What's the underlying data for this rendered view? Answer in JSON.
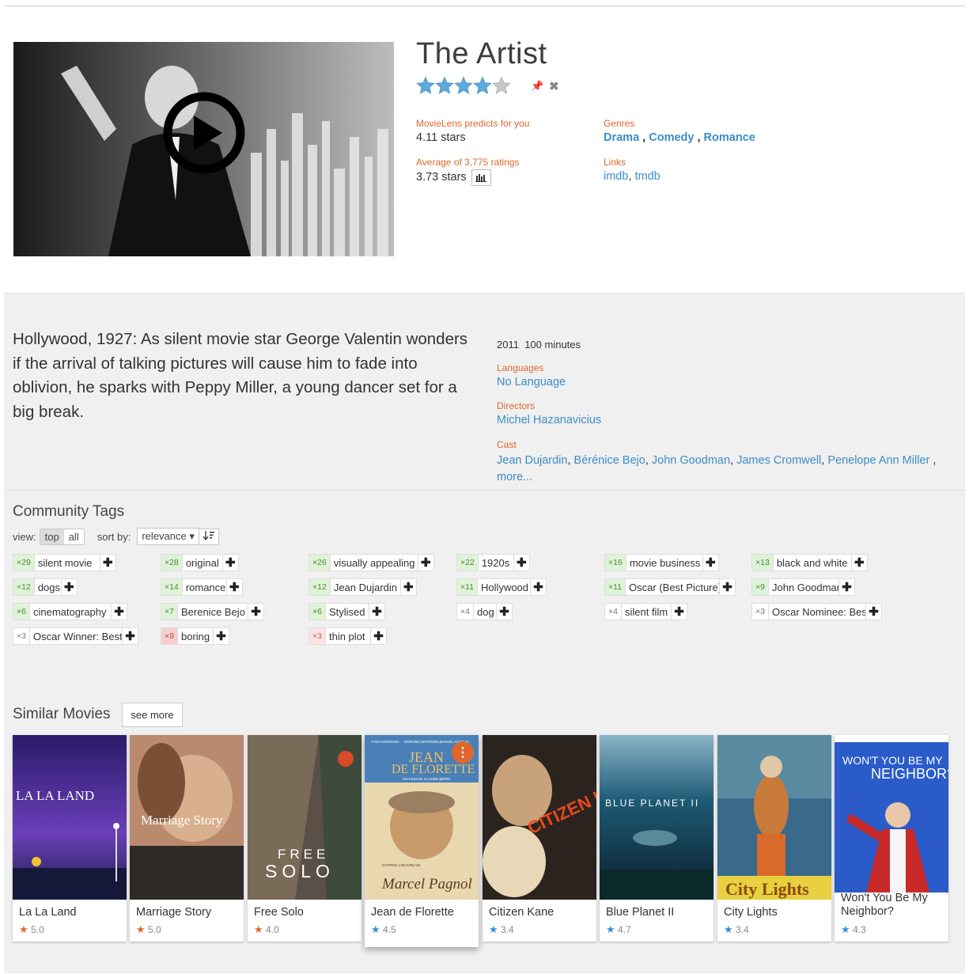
{
  "movie": {
    "title": "The Artist",
    "rating_stars": 4,
    "predict_label": "MovieLens predicts for you",
    "predict_value": "4.11 stars",
    "average_label": "Average of 3,775 ratings",
    "average_value": "3.73 stars",
    "genres_label": "Genres",
    "genres": [
      "Drama",
      "Comedy",
      "Romance"
    ],
    "links_label": "Links",
    "links": [
      "imdb",
      "tmdb"
    ]
  },
  "details": {
    "plot": "Hollywood, 1927: As silent movie star George Valentin wonders if the arrival of talking pictures will cause him to fade into oblivion, he sparks with Peppy Miller, a young dancer set for a big break.",
    "year": "2011",
    "runtime": "100 minutes",
    "languages_label": "Languages",
    "language": "No Language",
    "directors_label": "Directors",
    "director": "Michel Hazanavicius",
    "cast_label": "Cast",
    "cast": [
      "Jean Dujardin",
      "Bérénice Bejo",
      "John Goodman",
      "James Cromwell",
      "Penelope Ann Miller"
    ],
    "more": "more..."
  },
  "tags_section": {
    "title": "Community Tags",
    "view_label": "view:",
    "view_top": "top",
    "view_all": "all",
    "sort_label": "sort by:",
    "sort_value": "relevance ▾",
    "tags": [
      {
        "count": "×29",
        "name": "silent movie",
        "style": "green"
      },
      {
        "count": "×28",
        "name": "original",
        "style": "green"
      },
      {
        "count": "×26",
        "name": "visually appealing",
        "style": "green"
      },
      {
        "count": "×22",
        "name": "1920s",
        "style": "green"
      },
      {
        "count": "×16",
        "name": "movie business",
        "style": "green"
      },
      {
        "count": "×13",
        "name": "black and white",
        "style": "green"
      },
      {
        "count": "×12",
        "name": "dogs",
        "style": "green"
      },
      {
        "count": "×14",
        "name": "romance",
        "style": "green"
      },
      {
        "count": "×12",
        "name": "Jean Dujardin",
        "style": "green"
      },
      {
        "count": "×11",
        "name": "Hollywood",
        "style": "green"
      },
      {
        "count": "×11",
        "name": "Oscar (Best Picture)",
        "style": "green"
      },
      {
        "count": "×9",
        "name": "John Goodman",
        "style": "green"
      },
      {
        "count": "×6",
        "name": "cinematography",
        "style": "green"
      },
      {
        "count": "×7",
        "name": "Berenice Bejo",
        "style": "green"
      },
      {
        "count": "×6",
        "name": "Stylised",
        "style": "green"
      },
      {
        "count": "×4",
        "name": "dog",
        "style": "white"
      },
      {
        "count": "×4",
        "name": "silent film",
        "style": "white"
      },
      {
        "count": "×3",
        "name": "Oscar Nominee: Best",
        "style": "white"
      },
      {
        "count": "×3",
        "name": "Oscar Winner: Best",
        "style": "white"
      },
      {
        "count": "×9",
        "name": "boring",
        "style": "red"
      },
      {
        "count": "×3",
        "name": "thin plot",
        "style": "pink"
      }
    ]
  },
  "similar": {
    "title": "Similar Movies",
    "see_more": "see more",
    "movies": [
      {
        "title": "La La Land",
        "rating": "5.0",
        "star_color": "#e0662e"
      },
      {
        "title": "Marriage Story",
        "rating": "5.0",
        "star_color": "#e0662e"
      },
      {
        "title": "Free Solo",
        "rating": "4.0",
        "star_color": "#e0662e"
      },
      {
        "title": "Jean de Florette",
        "rating": "4.5",
        "star_color": "#3b8dc8"
      },
      {
        "title": "Citizen Kane",
        "rating": "3.4",
        "star_color": "#3b8dc8"
      },
      {
        "title": "Blue Planet II",
        "rating": "4.7",
        "star_color": "#3b8dc8"
      },
      {
        "title": "City Lights",
        "rating": "3.4",
        "star_color": "#3b8dc8"
      },
      {
        "title": "Won't You Be My Neighbor?",
        "rating": "4.3",
        "star_color": "#3b8dc8"
      }
    ],
    "poster_text": {
      "lalaland": "LA LA LAND",
      "marriage": "Marriage Story",
      "freesolo_1": "FREE",
      "freesolo_2": "SOLO",
      "florette_1": "JEAN",
      "florette_2": "DE FLORETTE",
      "florette_sig": "Marcel Pagnol",
      "florette_cast_1": "YVES MONTAND",
      "florette_cast_2": "GERARD DEPARDIEU",
      "florette_cast_3": "DANIEL AUTEUIL",
      "florette_dir": "UN FILM DE CLAUDE BERRI",
      "florette_credit": "D'APRÈS L'ŒUVRE DE",
      "kane": "CITIZEN KANE",
      "blueplanet": "BLUE PLANET II",
      "citylights": "City Lights",
      "neighbor_1": "WON'T YOU BE MY",
      "neighbor_2": "NEIGHBOR?"
    }
  },
  "colors": {
    "accent": "#e0662e",
    "link": "#3b8dc8",
    "star": "#5ea9dd"
  }
}
